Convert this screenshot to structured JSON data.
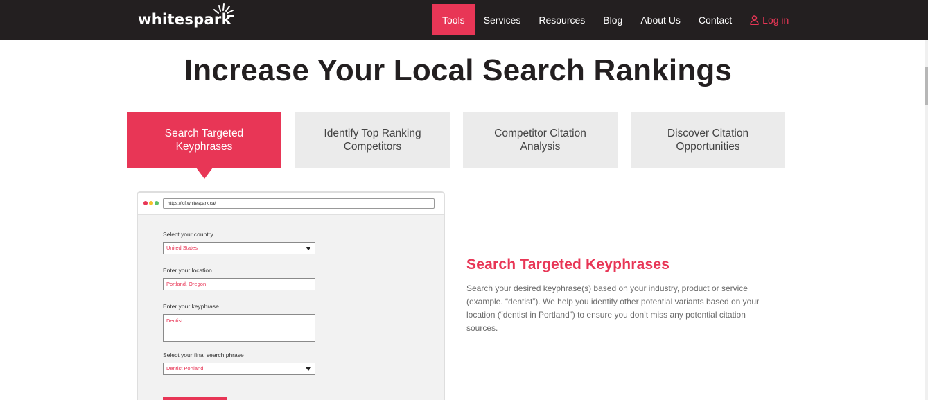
{
  "brand": {
    "logo_text": "whitespark",
    "accent": "#e83656",
    "nav_bg": "#231f20"
  },
  "nav": {
    "items": [
      {
        "label": "Tools",
        "active": true
      },
      {
        "label": "Services"
      },
      {
        "label": "Resources"
      },
      {
        "label": "Blog"
      },
      {
        "label": "About Us"
      },
      {
        "label": "Contact"
      }
    ],
    "login": {
      "label": "Log in",
      "icon": "user-icon"
    }
  },
  "page": {
    "title": "Increase Your Local Search Rankings"
  },
  "tabs": [
    {
      "label": "Search Targeted Keyphrases",
      "active": true
    },
    {
      "label": "Identify Top Ranking Competitors"
    },
    {
      "label": "Competitor Citation Analysis"
    },
    {
      "label": "Discover Citation Opportunities"
    }
  ],
  "mock": {
    "url": "https://lcf.whitespark.ca/",
    "country_label": "Select your country",
    "country_value": "United States",
    "location_label": "Enter your location",
    "location_value": "Portland, Oregon",
    "keyphrase_label": "Enter your keyphrase",
    "keyphrase_value": "Dentist",
    "final_label": "Select your final search phrase",
    "final_value": "Dentist Portland"
  },
  "detail": {
    "title": "Search Targeted Keyphrases",
    "body": "Search your desired keyphrase(s) based on your industry, product or service (example. “dentist”). We help you identify other potential variants based on your location (“dentist in Portland”) to ensure you don’t miss any potential citation sources."
  }
}
